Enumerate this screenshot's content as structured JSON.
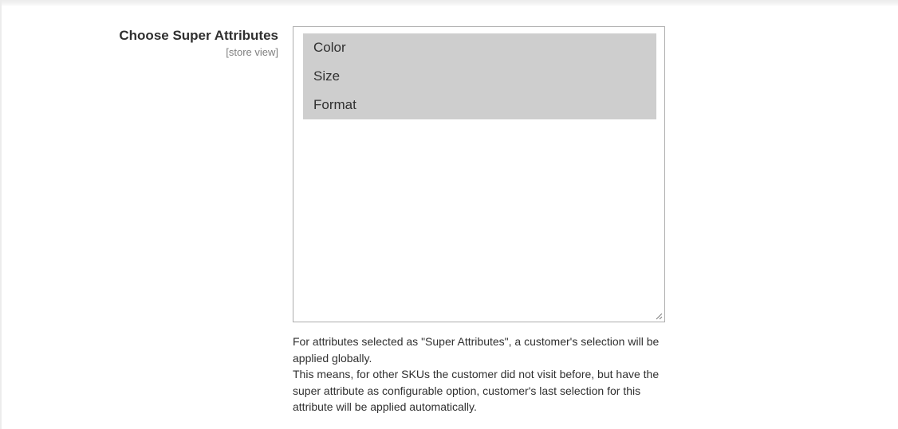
{
  "field": {
    "label": "Choose Super Attributes",
    "scope": "[store view]"
  },
  "multiselect": {
    "options": [
      {
        "label": "Color",
        "selected": true
      },
      {
        "label": "Size",
        "selected": true
      },
      {
        "label": "Format",
        "selected": true
      }
    ],
    "selected_bg": "#cecece",
    "border_color": "#adadad"
  },
  "note": {
    "line1": "For attributes selected as \"Super Attributes\", a customer's selection will be applied globally.",
    "line2": "This means, for other SKUs the customer did not visit before, but have the super attribute as configurable option, customer's last selection for this attribute will be applied automatically."
  }
}
